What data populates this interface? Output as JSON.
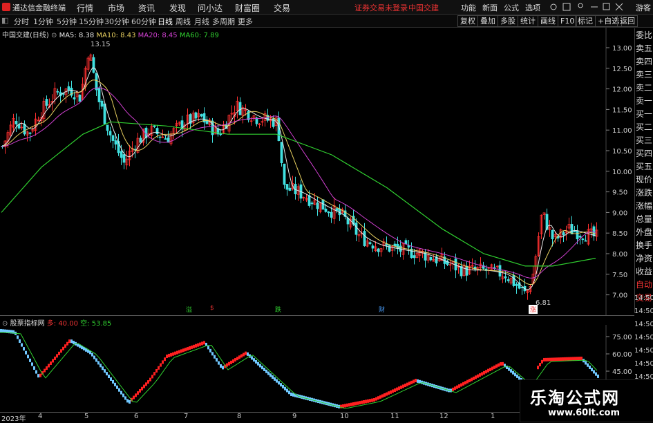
{
  "menubar": {
    "app_title": "通达信金融终端",
    "items": [
      "行情",
      "市场",
      "资讯",
      "发现",
      "问小达",
      "财富圈",
      "交易"
    ],
    "warning": "证券交易未登录",
    "stock": "中国交建",
    "right_items": [
      "功能",
      "新面",
      "公式",
      "选项"
    ],
    "guest": "游客"
  },
  "periods": {
    "items": [
      "分时",
      "1分钟",
      "5分钟",
      "15分钟",
      "30分钟",
      "60分钟",
      "日线",
      "周线",
      "月线",
      "多周期",
      "更多"
    ],
    "selected": "日线",
    "tools": [
      "复权",
      "叠加",
      "多股",
      "统计",
      "画线",
      "F10",
      "标记",
      "+自选",
      "返回"
    ]
  },
  "main_chart": {
    "title": "中国交建(日线)",
    "ma": [
      {
        "label": "MA5: 8.38",
        "color": "#e8e8e8"
      },
      {
        "label": "MA10: 8.43",
        "color": "#e8d060"
      },
      {
        "label": "MA20: 8.45",
        "color": "#d040d0"
      },
      {
        "label": "MA60: 7.89",
        "color": "#30d030"
      }
    ],
    "high_label": "13.15",
    "low_label": "6.81",
    "ylabels": [
      "13.00",
      "12.50",
      "12.00",
      "11.50",
      "11.00",
      "10.50",
      "10.00",
      "9.50",
      "9.00",
      "8.50",
      "8.00",
      "7.50",
      "7.00"
    ],
    "markers": [
      {
        "text": "溢",
        "color": "#30d030",
        "bg": "transparent"
      },
      {
        "text": "$",
        "color": "#e33",
        "bg": "transparent"
      },
      {
        "text": "跌",
        "color": "#30d030",
        "bg": "transparent"
      },
      {
        "text": "财",
        "color": "#4aa0ff",
        "bg": "transparent"
      },
      {
        "text": "涨",
        "color": "#e33",
        "bg": "#fff"
      }
    ]
  },
  "right_panel": {
    "items": [
      "委比",
      "卖五",
      "卖四",
      "卖三",
      "卖二",
      "卖一",
      "买一",
      "买二",
      "买三",
      "买四",
      "买五",
      "现价",
      "涨跌",
      "涨幅",
      "总量",
      "外盘",
      "换手",
      "净资",
      "收益",
      "自动",
      "交易"
    ],
    "times": [
      "14:50",
      "14:50",
      "14:50",
      "14:50",
      "14:50",
      "14:50",
      "14:50"
    ]
  },
  "indicator": {
    "title": "股票指标网",
    "duo": "多: 40.00",
    "kong": "空: 53.85",
    "ylabels": [
      "75.00",
      "60.00",
      "45.00"
    ]
  },
  "xaxis": {
    "labels": [
      "2023年",
      "4",
      "5",
      "6",
      "7",
      "8",
      "9",
      "10",
      "11",
      "12",
      "1"
    ]
  },
  "watermark": {
    "text": "乐淘公式网",
    "url": "www.60lt.com"
  }
}
